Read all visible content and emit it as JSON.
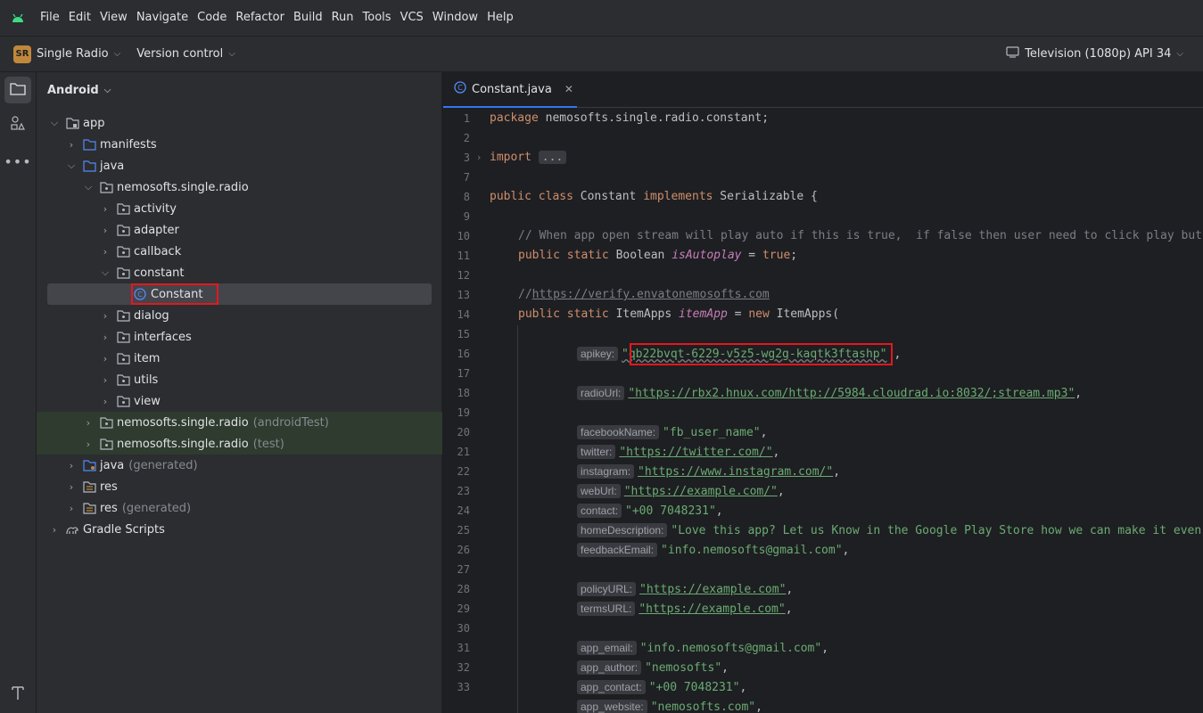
{
  "menu": {
    "items": [
      "File",
      "Edit",
      "View",
      "Navigate",
      "Code",
      "Refactor",
      "Build",
      "Run",
      "Tools",
      "VCS",
      "Window",
      "Help"
    ]
  },
  "toolbar": {
    "project_badge": "SR",
    "project_name": "Single Radio",
    "version_control": "Version control",
    "device": "Television (1080p) API 34"
  },
  "project_panel": {
    "title": "Android",
    "tree": [
      {
        "label": "app",
        "sub": ""
      },
      {
        "label": "manifests",
        "sub": ""
      },
      {
        "label": "java",
        "sub": ""
      },
      {
        "label": "nemosofts.single.radio",
        "sub": ""
      },
      {
        "label": "activity",
        "sub": ""
      },
      {
        "label": "adapter",
        "sub": ""
      },
      {
        "label": "callback",
        "sub": ""
      },
      {
        "label": "constant",
        "sub": ""
      },
      {
        "label": "Constant",
        "sub": ""
      },
      {
        "label": "dialog",
        "sub": ""
      },
      {
        "label": "interfaces",
        "sub": ""
      },
      {
        "label": "item",
        "sub": ""
      },
      {
        "label": "utils",
        "sub": ""
      },
      {
        "label": "view",
        "sub": ""
      },
      {
        "label": "nemosofts.single.radio",
        "sub": "(androidTest)"
      },
      {
        "label": "nemosofts.single.radio",
        "sub": "(test)"
      },
      {
        "label": "java",
        "sub": "(generated)"
      },
      {
        "label": "res",
        "sub": ""
      },
      {
        "label": "res",
        "sub": "(generated)"
      },
      {
        "label": "Gradle Scripts",
        "sub": ""
      }
    ]
  },
  "editor": {
    "tab_label": "Constant.java",
    "line_numbers": [
      "1",
      "2",
      "3",
      "7",
      "8",
      "9",
      "10",
      "11",
      "12",
      "13",
      "14",
      "15",
      "16",
      "17",
      "18",
      "19",
      "20",
      "21",
      "22",
      "23",
      "24",
      "25",
      "26",
      "27",
      "28",
      "29",
      "30",
      "31",
      "32",
      "33"
    ],
    "code": {
      "l1_kw": "package",
      "l1_rest": " nemosofts.single.radio.constant;",
      "l3_kw": "import",
      "l3_dots": "...",
      "l7_kw1": "public class",
      "l7_name": " Constant ",
      "l7_kw2": "implements",
      "l7_rest": " Serializable {",
      "l9_comment": "// When app open stream will play auto if this is true,  if false then user need to click play button",
      "l10_kw": "public static",
      "l10_type": " Boolean ",
      "l10_field": "isAutoplay",
      "l10_eq": " = ",
      "l10_val": "true",
      "l10_end": ";",
      "l12_comment": "//",
      "l12_link": "https://verify.envatonemosofts.com",
      "l13_kw": "public static",
      "l13_type": " ItemApps ",
      "l13_field": "itemApp",
      "l13_eq": " = ",
      "l13_new": "new",
      "l13_rest": " ItemApps(",
      "apikey_hint": "apikey:",
      "apikey_value": "\"qb22bvqt-6229-v5z5-wg2g-kaqtk3ftashp\"",
      "radio_hint": "radioUrl:",
      "radio_value": "\"https://rbx2.hnux.com/http://5984.cloudrad.io:8032/;stream.mp3\"",
      "facebook_hint": "facebookName:",
      "facebook_value": "\"fb_user_name\"",
      "twitter_hint": "twitter:",
      "twitter_value": "\"https://twitter.com/\"",
      "instagram_hint": "instagram:",
      "instagram_value": "\"https://www.instagram.com/\"",
      "web_hint": "webUrl:",
      "web_value": "\"https://example.com/\"",
      "contact_hint": "contact:",
      "contact_value": "\"+00 7048231\"",
      "homedesc_hint": "homeDescription:",
      "homedesc_value": "\"Love this app? Let us Know in the Google Play Store how we can make it even better\"",
      "feedback_hint": "feedbackEmail:",
      "feedback_value": "\"info.nemosofts@gmail.com\"",
      "policy_hint": "policyURL:",
      "policy_value": "\"https://example.com\"",
      "terms_hint": "termsURL:",
      "terms_value": "\"https://example.com\"",
      "appemail_hint": "app_email:",
      "appemail_value": "\"info.nemosofts@gmail.com\"",
      "appauthor_hint": "app_author:",
      "appauthor_value": "\"nemosofts\"",
      "appcontact_hint": "app_contact:",
      "appcontact_value": "\"+00 7048231\"",
      "appwebsite_hint": "app_website:",
      "appwebsite_value": "\"nemosofts.com\"",
      "comma": ","
    }
  },
  "colors": {
    "accent": "#3574f0",
    "highlight_box": "#e3181e",
    "string": "#6aab73",
    "keyword": "#cf8e6d"
  }
}
